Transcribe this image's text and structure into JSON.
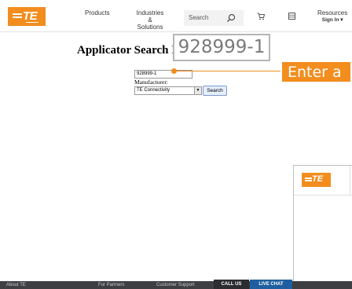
{
  "header": {
    "logo_text": "TE",
    "nav_products": "Products",
    "nav_industries_line1": "Industries &",
    "nav_industries_line2": "Solutions",
    "search_placeholder": "Search",
    "resources_label": "Resources",
    "sign_in_label": "Sign In ▾"
  },
  "main": {
    "title": "Applicator Search I",
    "part_number_value": "928999-1",
    "manufacturer_label": "Manufacturer:",
    "manufacturer_selected": "TE Connectivity",
    "search_button_label": "Search"
  },
  "overlay": {
    "zoom_text": "928999-1",
    "callout_text": "Enter a",
    "accent_color": "#f28d1e"
  },
  "popup": {
    "logo_text": "TE"
  },
  "footer": {
    "about": "About TE",
    "partners": "For Partners",
    "support": "Customer Support",
    "call_us": "CALL US",
    "live_chat": "LIVE CHAT"
  }
}
